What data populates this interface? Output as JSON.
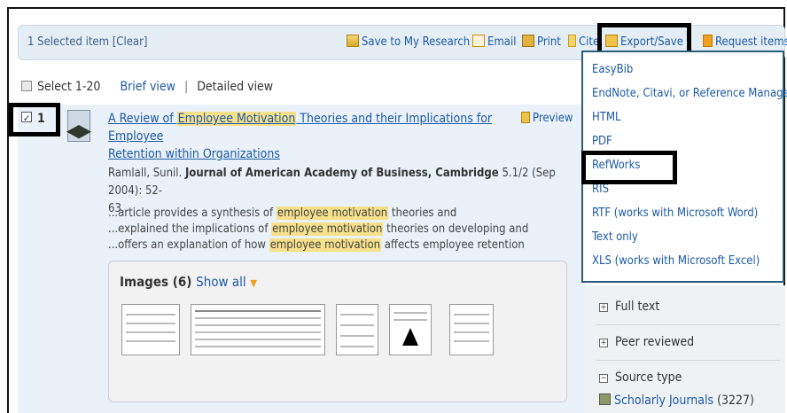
{
  "toolbar": {
    "selected_text": "1 Selected item",
    "clear_label": "[Clear]",
    "save_research": "Save to My Research",
    "email": "Email",
    "print": "Print",
    "cite": "Cite",
    "export_save": "Export/Save",
    "request_items": "Request items"
  },
  "view": {
    "select_label": "Select 1-20",
    "brief": "Brief view",
    "separator": "|",
    "detailed": "Detailed view"
  },
  "result": {
    "number": "1",
    "title_line1_pre": "A Review of ",
    "title_highlight": "Employee Motivation",
    "title_line1_post": " Theories and their Implications for Employee",
    "title_line2": "Retention within Organizations",
    "preview": "Preview",
    "author": "Ramlall, Sunil.",
    "journal": "Journal of American Academy of Business, Cambridge",
    "citation_rest": "5.1/2  (Sep 2004): 52-",
    "citation_rest2": "63.",
    "snippets": [
      {
        "pre": "...article provides a synthesis of ",
        "hl": "employee motivation",
        "post": " theories and"
      },
      {
        "pre": "...explained the implications of ",
        "hl": "employee motivation",
        "post": " theories on developing and"
      },
      {
        "pre": "...offers an explanation of how ",
        "hl": "employee motivation",
        "post": " affects employee retention"
      }
    ],
    "images_title": "Images (6)",
    "show_all": "Show all"
  },
  "export_menu": {
    "items": [
      "EasyBib",
      "EndNote, Citavi, or Reference Manager",
      "HTML",
      "PDF",
      "RefWorks",
      "RIS",
      "RTF (works with Microsoft Word)",
      "Text only",
      "XLS (works with Microsoft Excel)"
    ]
  },
  "sidebar": {
    "full_text": "Full text",
    "peer_reviewed": "Peer reviewed",
    "source_type": "Source type",
    "scholarly": "Scholarly Journals",
    "scholarly_count": "(3227)"
  }
}
